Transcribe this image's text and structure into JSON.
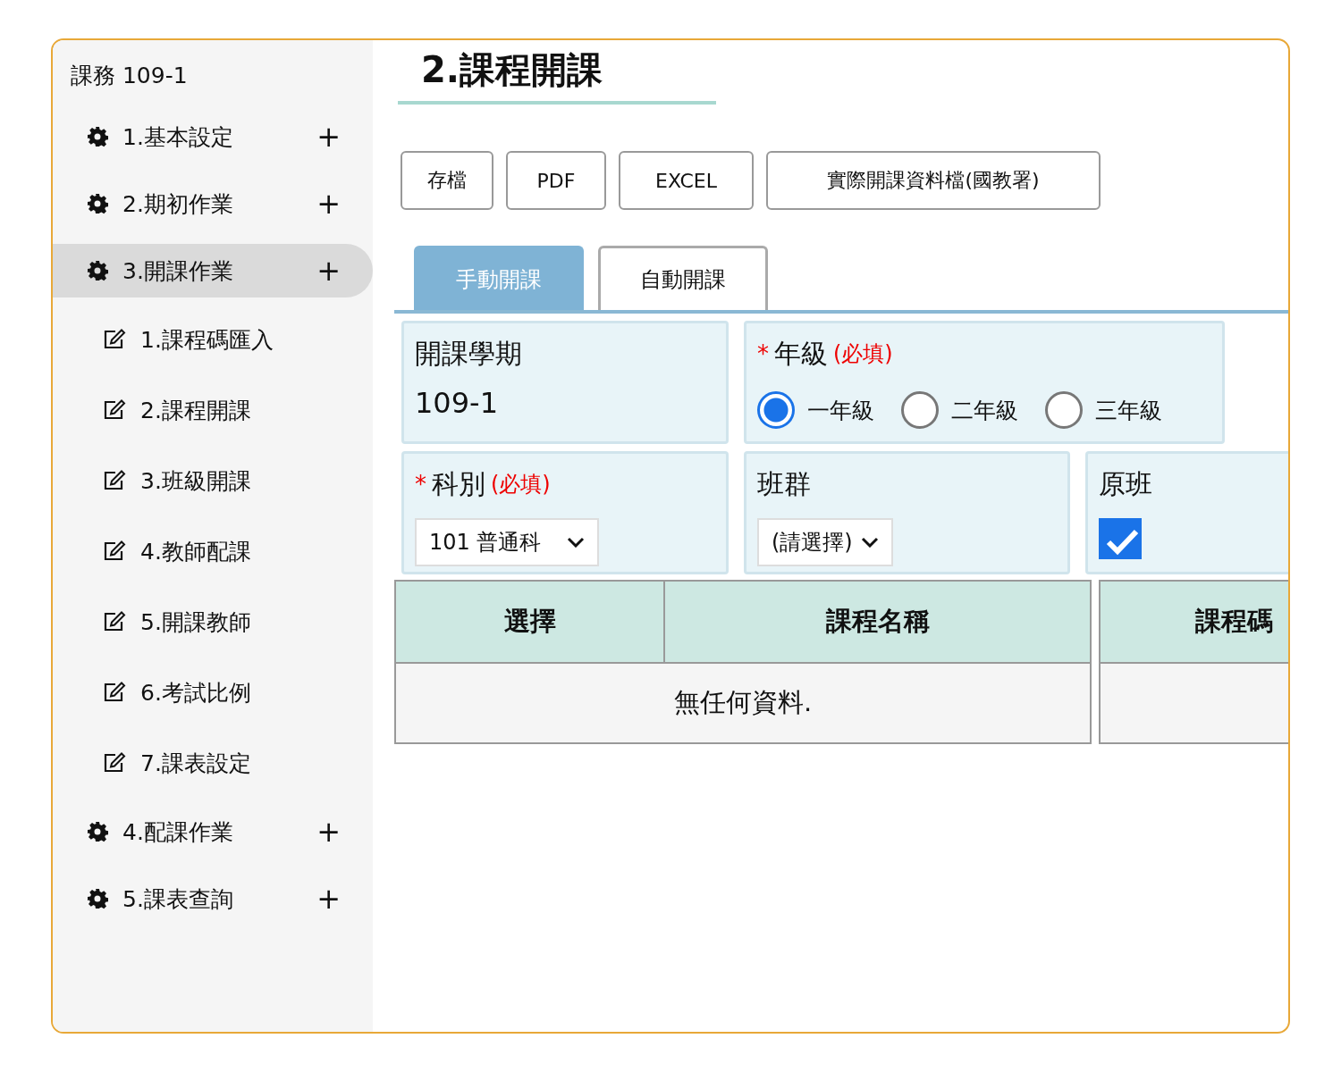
{
  "sidebar": {
    "title": "課務 109-1",
    "items": [
      {
        "label": "1.基本設定",
        "toggle": "+",
        "selected": false
      },
      {
        "label": "2.期初作業",
        "toggle": "+",
        "selected": false
      },
      {
        "label": "3.開課作業",
        "toggle": "+",
        "selected": true,
        "children": [
          {
            "label": "1.課程碼匯入",
            "selected": false
          },
          {
            "label": "2.課程開課",
            "selected": false
          },
          {
            "label": "3.班級開課",
            "selected": false
          },
          {
            "label": "4.教師配課",
            "selected": false
          },
          {
            "label": "5.開課教師",
            "selected": false
          },
          {
            "label": "6.考試比例",
            "selected": false
          },
          {
            "label": "7.課表設定",
            "selected": false
          }
        ]
      },
      {
        "label": "4.配課作業",
        "toggle": "+",
        "selected": false
      },
      {
        "label": "5.課表查詢",
        "toggle": "+",
        "selected": false
      }
    ]
  },
  "page": {
    "title": "2.課程開課",
    "buttons": [
      "存檔",
      "PDF",
      "EXCEL",
      "實際開課資料檔(國教署)"
    ],
    "tabs": [
      {
        "label": "手動開課",
        "selected": true
      },
      {
        "label": "自動開課",
        "selected": false
      }
    ],
    "semester": {
      "label": "開課學期",
      "value": "109-1"
    },
    "grade": {
      "required_mark": "*",
      "label": "年級",
      "required_note": "(必填)",
      "options": [
        {
          "label": "一年級",
          "selected": true
        },
        {
          "label": "二年級",
          "selected": false
        },
        {
          "label": "三年級",
          "selected": false
        }
      ]
    },
    "department": {
      "required_mark": "*",
      "label": "科別",
      "required_note": "(必填)",
      "value": "101 普通科"
    },
    "class_group": {
      "label": "班群",
      "value": "(請選擇)"
    },
    "original_class": {
      "label": "原班",
      "checked": true
    },
    "table": {
      "columns": [
        "選擇",
        "課程名稱",
        "課程碼"
      ],
      "empty_message": "無任何資料."
    }
  }
}
